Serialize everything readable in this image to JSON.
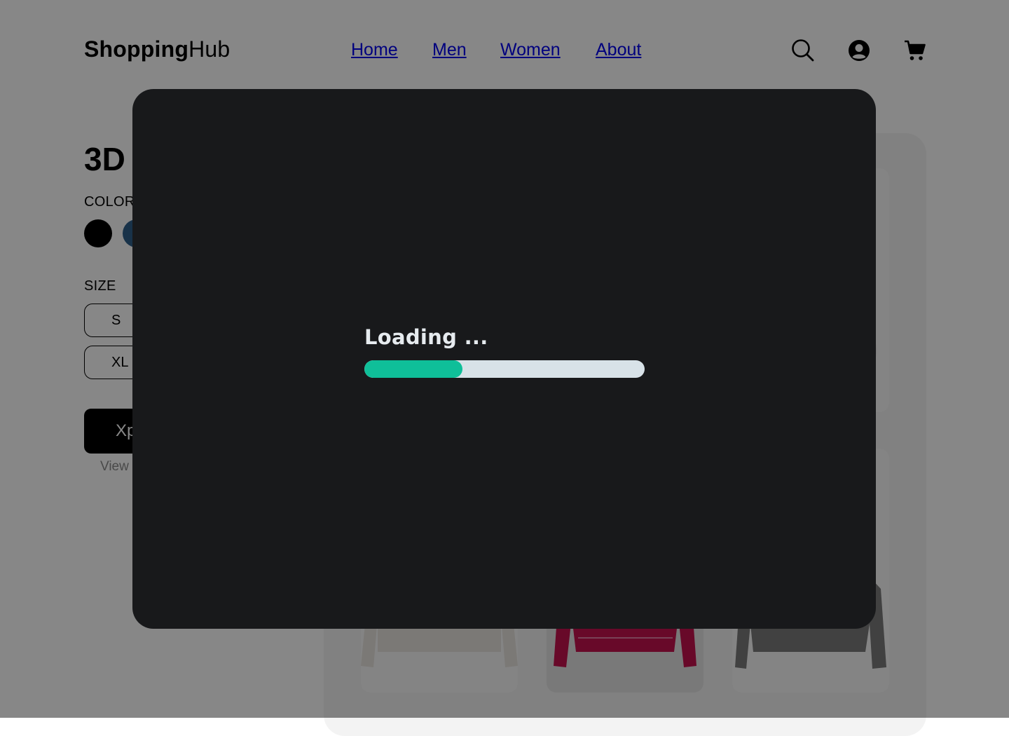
{
  "header": {
    "logo_bold": "Shopping",
    "logo_light": "Hub",
    "nav": [
      {
        "label": "Home"
      },
      {
        "label": "Men"
      },
      {
        "label": "Women"
      },
      {
        "label": "About"
      }
    ],
    "icons": [
      "search-icon",
      "account-icon",
      "cart-icon"
    ]
  },
  "product": {
    "title_partial": "3D",
    "color_label": "COLOR",
    "colors": [
      "#000000",
      "#2f5f8a"
    ],
    "size_label": "SIZE",
    "sizes": [
      "S",
      "XL"
    ],
    "cta_partial": "Xp",
    "link_partial": "View"
  },
  "gallery": {
    "thumb_colors": [
      "#e9e4df",
      "#c4124e",
      "#7b7b7b"
    ]
  },
  "modal": {
    "loading_text": "Loading ...",
    "progress": 0.35,
    "progress_color": "#0fbf99",
    "track_color": "#d8e2e8"
  }
}
